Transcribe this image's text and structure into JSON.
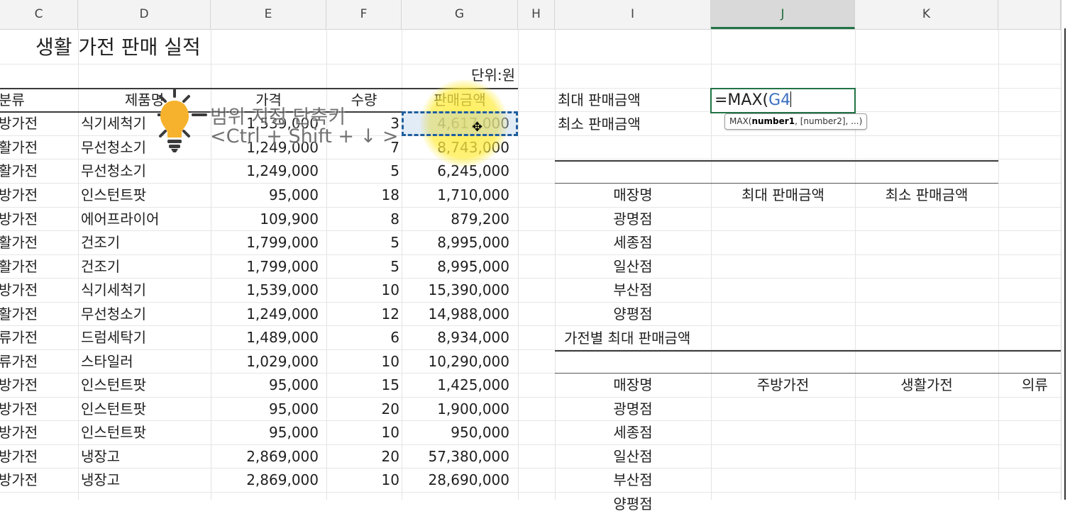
{
  "columns": [
    "C",
    "D",
    "E",
    "F",
    "G",
    "H",
    "I",
    "J",
    "K"
  ],
  "active_column": "J",
  "sheet": {
    "title": "생활 가전 판매 실적",
    "unit": "단위:원",
    "headers": [
      "분류",
      "제품명",
      "가격",
      "수량",
      "판매금액"
    ],
    "rows": [
      {
        "category": "방가전",
        "product": "식기세척기",
        "price": "1,539,000",
        "qty": "3",
        "amount": "4,617,000"
      },
      {
        "category": "활가전",
        "product": "무선청소기",
        "price": "1,249,000",
        "qty": "7",
        "amount": "8,743,000"
      },
      {
        "category": "활가전",
        "product": "무선청소기",
        "price": "1,249,000",
        "qty": "5",
        "amount": "6,245,000"
      },
      {
        "category": "방가전",
        "product": "인스턴트팟",
        "price": "95,000",
        "qty": "18",
        "amount": "1,710,000"
      },
      {
        "category": "방가전",
        "product": "에어프라이어",
        "price": "109,900",
        "qty": "8",
        "amount": "879,200"
      },
      {
        "category": "활가전",
        "product": "건조기",
        "price": "1,799,000",
        "qty": "5",
        "amount": "8,995,000"
      },
      {
        "category": "활가전",
        "product": "건조기",
        "price": "1,799,000",
        "qty": "5",
        "amount": "8,995,000"
      },
      {
        "category": "방가전",
        "product": "식기세척기",
        "price": "1,539,000",
        "qty": "10",
        "amount": "15,390,000"
      },
      {
        "category": "활가전",
        "product": "무선청소기",
        "price": "1,249,000",
        "qty": "12",
        "amount": "14,988,000"
      },
      {
        "category": "류가전",
        "product": "드럼세탁기",
        "price": "1,489,000",
        "qty": "6",
        "amount": "8,934,000"
      },
      {
        "category": "류가전",
        "product": "스타일러",
        "price": "1,029,000",
        "qty": "10",
        "amount": "10,290,000"
      },
      {
        "category": "방가전",
        "product": "인스턴트팟",
        "price": "95,000",
        "qty": "15",
        "amount": "1,425,000"
      },
      {
        "category": "방가전",
        "product": "인스턴트팟",
        "price": "95,000",
        "qty": "20",
        "amount": "1,900,000"
      },
      {
        "category": "방가전",
        "product": "인스턴트팟",
        "price": "95,000",
        "qty": "10",
        "amount": "950,000"
      },
      {
        "category": "방가전",
        "product": "냉장고",
        "price": "2,869,000",
        "qty": "20",
        "amount": "57,380,000"
      },
      {
        "category": "방가전",
        "product": "냉장고",
        "price": "2,869,000",
        "qty": "10",
        "amount": "28,690,000"
      }
    ]
  },
  "summary": {
    "max_label": "최대 판매금액",
    "min_label": "최소 판매금액",
    "formula_prefix": "=MAX(",
    "formula_ref": "G4",
    "tooltip_fn": "MAX(",
    "tooltip_arg1": "number1",
    "tooltip_rest": ", [number2], ...)"
  },
  "store_table": {
    "headers": [
      "매장명",
      "최대 판매금액",
      "최소 판매금액"
    ],
    "stores": [
      "광명점",
      "세종점",
      "일산점",
      "부산점",
      "양평점"
    ]
  },
  "type_table": {
    "title": "가전별 최대 판매금액",
    "headers": [
      "매장명",
      "주방가전",
      "생활가전",
      "의류"
    ],
    "stores": [
      "광명점",
      "세종점",
      "일산점",
      "부산점",
      "양평점"
    ]
  },
  "overlay": {
    "tip_line1": "범위 지정 단축키",
    "tip_line2": "<Ctrl + Shift + ↓ >",
    "cursor_glyph": "✥"
  }
}
